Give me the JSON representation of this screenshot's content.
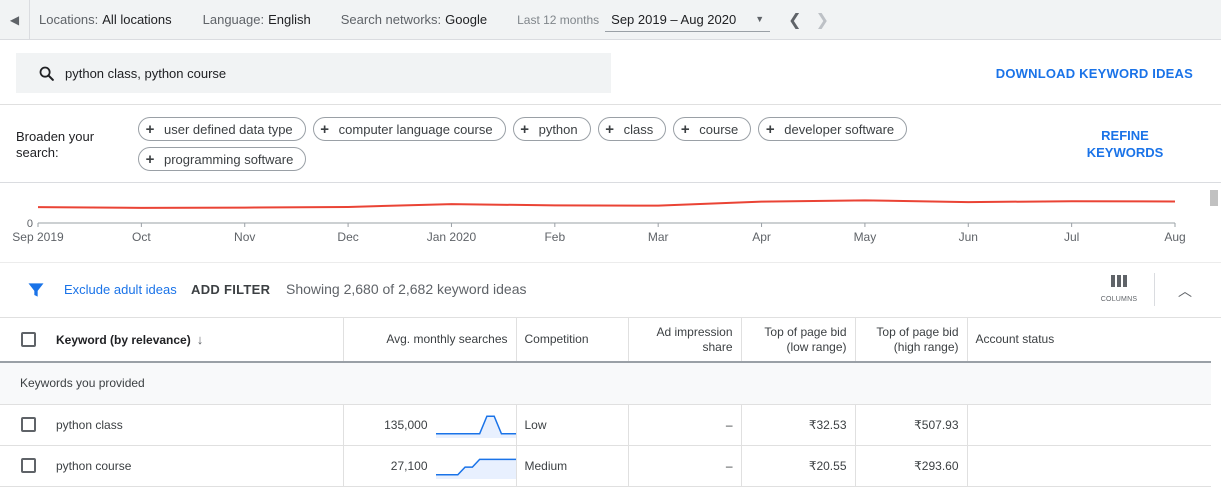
{
  "topbar": {
    "locations_label": "Locations:",
    "locations_value": "All locations",
    "language_label": "Language:",
    "language_value": "English",
    "networks_label": "Search networks:",
    "networks_value": "Google",
    "period_label": "Last 12 months",
    "date_range": "Sep 2019 – Aug 2020"
  },
  "search": {
    "query": "python class, python course",
    "download_label": "DOWNLOAD KEYWORD IDEAS"
  },
  "broaden": {
    "label": "Broaden your search:",
    "chips": [
      "user defined data type",
      "computer language course",
      "python",
      "class",
      "course",
      "developer software",
      "programming software"
    ],
    "refine_label": "REFINE KEYWORDS"
  },
  "chart_data": {
    "type": "line",
    "x": [
      "Sep 2019",
      "Oct",
      "Nov",
      "Dec",
      "Jan 2020",
      "Feb",
      "Mar",
      "Apr",
      "May",
      "Jun",
      "Jul",
      "Aug"
    ],
    "values": [
      0.72,
      0.69,
      0.7,
      0.73,
      0.86,
      0.8,
      0.79,
      0.97,
      1.03,
      0.95,
      0.99,
      0.98
    ],
    "y_ticks": [
      "0"
    ],
    "color": "#ea4335"
  },
  "filterbar": {
    "exclude_label": "Exclude adult ideas",
    "add_filter_label": "ADD FILTER",
    "showing_text": "Showing 2,680 of 2,682 keyword ideas",
    "columns_label": "COLUMNS"
  },
  "table": {
    "headers": {
      "keyword": "Keyword (by relevance)",
      "searches": "Avg. monthly searches",
      "competition": "Competition",
      "ad_share_1": "Ad impression",
      "ad_share_2": "share",
      "low_bid_1": "Top of page bid",
      "low_bid_2": "(low range)",
      "high_bid_1": "Top of page bid",
      "high_bid_2": "(high range)",
      "account": "Account status"
    },
    "section_label": "Keywords you provided",
    "rows": [
      {
        "keyword": "python class",
        "searches": "135,000",
        "competition": "Low",
        "ad_share": "–",
        "low_bid": "₹32.53",
        "high_bid": "₹507.93",
        "spark": [
          0.1,
          0.1,
          0.1,
          0.1,
          0.1,
          0.1,
          0.1,
          0.9,
          0.9,
          0.1,
          0.1,
          0.1
        ]
      },
      {
        "keyword": "python course",
        "searches": "27,100",
        "competition": "Medium",
        "ad_share": "–",
        "low_bid": "₹20.55",
        "high_bid": "₹293.60",
        "spark": [
          0.1,
          0.1,
          0.1,
          0.1,
          0.45,
          0.45,
          0.8,
          0.8,
          0.8,
          0.8,
          0.8,
          0.8
        ]
      }
    ]
  }
}
